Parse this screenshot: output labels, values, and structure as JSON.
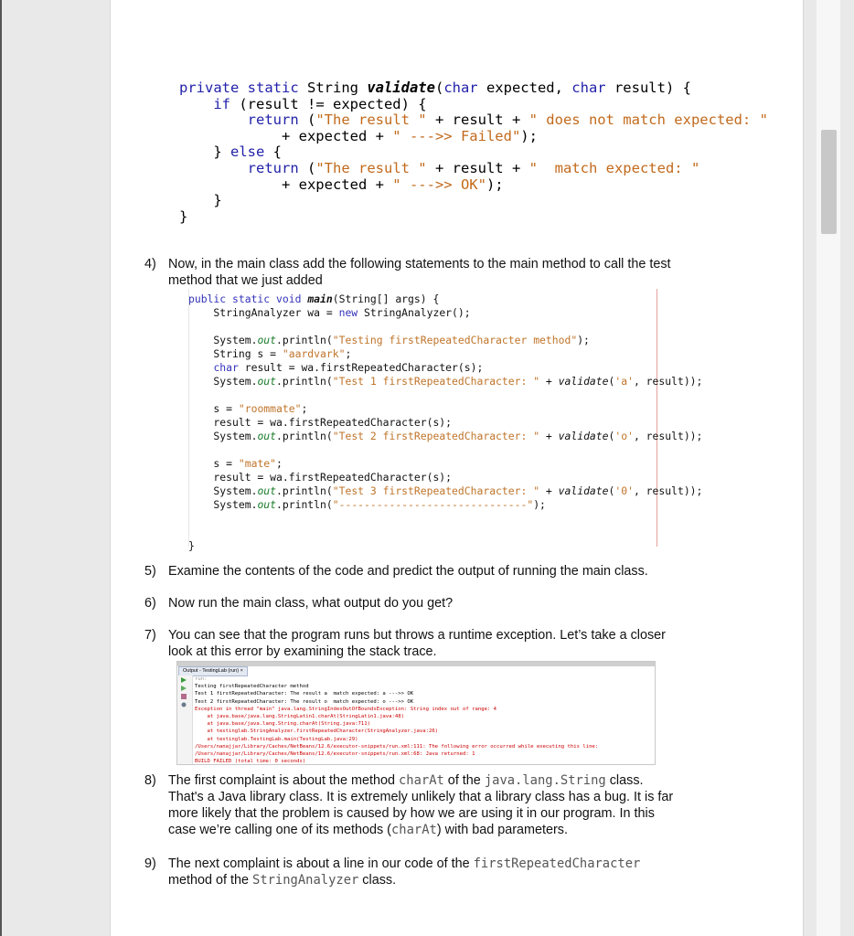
{
  "code_validate": [
    "private static String validate(char expected, char result) {",
    "    if (result != expected) {",
    "        return (\"The result \" + result + \" does not match expected: \"",
    "            + expected + \" --->> Failed\");",
    "    } else {",
    "        return (\"The result \" + result + \"  match expected: \"",
    "            + expected + \" --->> OK\");",
    "    }",
    "}"
  ],
  "steps": {
    "s4": {
      "num": "4)",
      "line1": "Now, in the main class add the following statements to the main method to call the test",
      "line2": "method that we just added"
    },
    "s5": {
      "num": "5)",
      "text": "Examine the contents of the code and predict the output of running the main class."
    },
    "s6": {
      "num": "6)",
      "text": "Now run the main class, what output do you get?"
    },
    "s7": {
      "num": "7)",
      "line1": "You can see that the program runs but throws a runtime exception. Let’s take a closer",
      "line2": "look at this error by examining the stack trace."
    },
    "s8": {
      "num": "8)",
      "l1a": "The first complaint is about the method ",
      "l1m": "charAt",
      "l1b": " of the ",
      "l1m2": "java.lang.String",
      "l1c": " class.",
      "l2": "That's a Java library class. It is extremely unlikely that a library class has a bug. It is far",
      "l3": "more likely that the problem is caused by how we are using it in our program. In this",
      "l4a": "case we’re calling one of its methods (",
      "l4m": "charAt",
      "l4b": ") with bad parameters."
    },
    "s9": {
      "num": "9)",
      "l1a": "The next complaint is about a line in our code of the ",
      "l1m": "firstRepeatedCharacter",
      "l2a": "method of the ",
      "l2m": "StringAnalyzer",
      "l2b": " class."
    }
  },
  "code_main": [
    "public static void main(String[] args) {",
    "    StringAnalyzer wa = new StringAnalyzer();",
    "",
    "    System.out.println(\"Testing firstRepeatedCharacter method\");",
    "    String s = \"aardvark\";",
    "    char result = wa.firstRepeatedCharacter(s);",
    "    System.out.println(\"Test 1 firstRepeatedCharacter: \" + validate('a', result));",
    "",
    "    s = \"roommate\";",
    "    result = wa.firstRepeatedCharacter(s);",
    "    System.out.println(\"Test 2 firstRepeatedCharacter: \" + validate('o', result));",
    "",
    "    s = \"mate\";",
    "    result = wa.firstRepeatedCharacter(s);",
    "    System.out.println(\"Test 3 firstRepeatedCharacter: \" + validate('0', result));",
    "    System.out.println(\"------------------------------\");",
    "",
    "",
    "}"
  ],
  "output": {
    "tab_label": "Output - TestingLab (run)",
    "close": "×",
    "lines": [
      "run:",
      "Testing firstRepeatedCharacter method",
      "Test 1 firstRepeatedCharacter: The result a  match expected: a --->> OK",
      "Test 2 firstRepeatedCharacter: The result o  match expected: o --->> OK",
      "Exception in thread \"main\" java.lang.StringIndexOutOfBoundsException: String index out of range: 4",
      "    at java.base/java.lang.StringLatin1.charAt(StringLatin1.java:48)",
      "    at java.base/java.lang.String.charAt(String.java:711)",
      "    at testinglab.StringAnalyzer.firstRepeatedCharacter(StringAnalyzer.java:26)",
      "    at testinglab.TestingLab.main(TestingLab.java:29)",
      "/Users/nanajjar/Library/Caches/NetBeans/12.6/executor-snippets/run.xml:111: The following error occurred while executing this line:",
      "/Users/nanajjar/Library/Caches/NetBeans/12.6/executor-snippets/run.xml:68: Java returned: 1",
      "BUILD FAILED (total time: 0 seconds)"
    ]
  },
  "colors": {
    "keyword": "#2222aa",
    "string": "#c26a1c",
    "field": "#1a7a2a",
    "error": "#cc0000"
  }
}
